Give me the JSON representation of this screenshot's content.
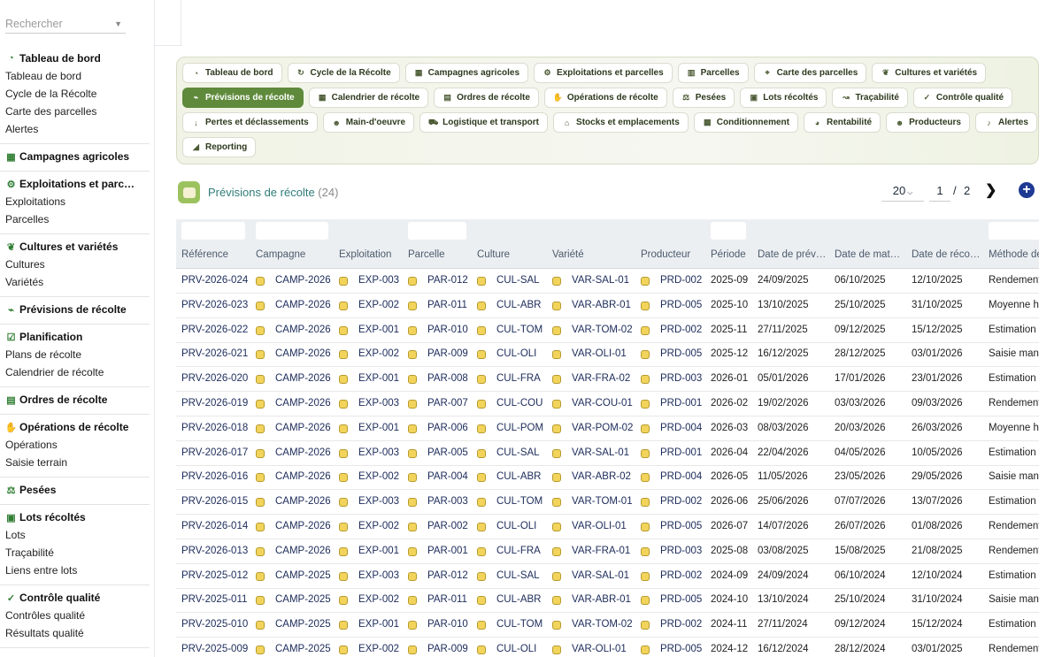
{
  "sidebar": {
    "search_placeholder": "Rechercher",
    "sections": [
      {
        "title": "Tableau de bord",
        "icon": "gauge-icon",
        "items": [
          "Tableau de bord",
          "Cycle de la Récolte",
          "Carte des parcelles",
          "Alertes"
        ]
      },
      {
        "title": "Campagnes agricoles",
        "icon": "calendar-icon",
        "items": []
      },
      {
        "title": "Exploitations et parc…",
        "icon": "tractor-icon",
        "items": [
          "Exploitations",
          "Parcelles"
        ]
      },
      {
        "title": "Cultures et variétés",
        "icon": "seedling-icon",
        "items": [
          "Cultures",
          "Variétés"
        ]
      },
      {
        "title": "Prévisions de récolte",
        "icon": "chart-line-icon",
        "items": []
      },
      {
        "title": "Planification",
        "icon": "clipboard-check-icon",
        "items": [
          "Plans de récolte",
          "Calendrier de récolte"
        ]
      },
      {
        "title": "Ordres de récolte",
        "icon": "clipboard-icon",
        "items": []
      },
      {
        "title": "Opérations de récolte",
        "icon": "hand-icon",
        "items": [
          "Opérations",
          "Saisie terrain"
        ]
      },
      {
        "title": "Pesées",
        "icon": "scale-icon",
        "items": []
      },
      {
        "title": "Lots récoltés",
        "icon": "boxes-icon",
        "items": [
          "Lots",
          "Traçabilité",
          "Liens entre lots"
        ]
      },
      {
        "title": "Contrôle qualité",
        "icon": "check-icon",
        "items": [
          "Contrôles qualité",
          "Résultats qualité"
        ]
      }
    ]
  },
  "tabs": [
    [
      {
        "label": "Tableau de bord",
        "icon": "gauge-icon"
      },
      {
        "label": "Cycle de la Récolte",
        "icon": "sync-icon"
      },
      {
        "label": "Campagnes agricoles",
        "icon": "calendar-icon"
      },
      {
        "label": "Exploitations et parcelles",
        "icon": "tractor-icon"
      },
      {
        "label": "Parcelles",
        "icon": "map-icon"
      },
      {
        "label": "Carte des parcelles",
        "icon": "map-marked-icon"
      },
      {
        "label": "Cultures et variétés",
        "icon": "seedling-icon"
      }
    ],
    [
      {
        "label": "Prévisions de récolte",
        "icon": "chart-line-icon",
        "active": true
      },
      {
        "label": "Calendrier de récolte",
        "icon": "calendar-icon"
      },
      {
        "label": "Ordres de récolte",
        "icon": "clipboard-icon"
      },
      {
        "label": "Opérations de récolte",
        "icon": "hand-icon"
      },
      {
        "label": "Pesées",
        "icon": "scale-icon"
      },
      {
        "label": "Lots récoltés",
        "icon": "boxes-icon"
      },
      {
        "label": "Traçabilité",
        "icon": "route-icon"
      },
      {
        "label": "Contrôle qualité",
        "icon": "check-icon"
      }
    ],
    [
      {
        "label": "Pertes et déclassements",
        "icon": "arrow-down-icon"
      },
      {
        "label": "Main-d'oeuvre",
        "icon": "users-icon"
      },
      {
        "label": "Logistique et transport",
        "icon": "truck-icon"
      },
      {
        "label": "Stocks et emplacements",
        "icon": "warehouse-icon"
      },
      {
        "label": "Conditionnement",
        "icon": "pallet-icon"
      },
      {
        "label": "Rentabilité",
        "icon": "pie-chart-icon"
      },
      {
        "label": "Producteurs",
        "icon": "users-icon"
      },
      {
        "label": "Alertes",
        "icon": "bell-icon"
      }
    ],
    [
      {
        "label": "Reporting",
        "icon": "chart-area-icon"
      }
    ]
  ],
  "list": {
    "title": "Prévisions de récolte",
    "count": "(24)",
    "page_size": "20",
    "page": "1",
    "page_sep": "/",
    "total_pages": "2"
  },
  "columns": [
    "Référence",
    "Campagne",
    "Exploitation",
    "Parcelle",
    "Culture",
    "Variété",
    "Producteur",
    "Période",
    "Date de prév…",
    "Date de mat…",
    "Date de réco…",
    "Méthode de"
  ],
  "rows": [
    [
      "PRV-2026-024",
      "CAMP-2026",
      "EXP-003",
      "PAR-012",
      "CUL-SAL",
      "VAR-SAL-01",
      "PRD-002",
      "2025-09",
      "24/09/2025",
      "06/10/2025",
      "12/10/2025",
      "Rendement"
    ],
    [
      "PRV-2026-023",
      "CAMP-2026",
      "EXP-002",
      "PAR-011",
      "CUL-ABR",
      "VAR-ABR-01",
      "PRD-005",
      "2025-10",
      "13/10/2025",
      "25/10/2025",
      "31/10/2025",
      "Moyenne hi"
    ],
    [
      "PRV-2026-022",
      "CAMP-2026",
      "EXP-001",
      "PAR-010",
      "CUL-TOM",
      "VAR-TOM-02",
      "PRD-002",
      "2025-11",
      "27/11/2025",
      "09/12/2025",
      "15/12/2025",
      "Estimation a"
    ],
    [
      "PRV-2026-021",
      "CAMP-2026",
      "EXP-002",
      "PAR-009",
      "CUL-OLI",
      "VAR-OLI-01",
      "PRD-005",
      "2025-12",
      "16/12/2025",
      "28/12/2025",
      "03/01/2026",
      "Saisie manu"
    ],
    [
      "PRV-2026-020",
      "CAMP-2026",
      "EXP-001",
      "PAR-008",
      "CUL-FRA",
      "VAR-FRA-02",
      "PRD-003",
      "2026-01",
      "05/01/2026",
      "17/01/2026",
      "23/01/2026",
      "Estimation p"
    ],
    [
      "PRV-2026-019",
      "CAMP-2026",
      "EXP-003",
      "PAR-007",
      "CUL-COU",
      "VAR-COU-01",
      "PRD-001",
      "2026-02",
      "19/02/2026",
      "03/03/2026",
      "09/03/2026",
      "Rendement"
    ],
    [
      "PRV-2026-018",
      "CAMP-2026",
      "EXP-001",
      "PAR-006",
      "CUL-POM",
      "VAR-POM-02",
      "PRD-004",
      "2026-03",
      "08/03/2026",
      "20/03/2026",
      "26/03/2026",
      "Moyenne hi"
    ],
    [
      "PRV-2026-017",
      "CAMP-2026",
      "EXP-003",
      "PAR-005",
      "CUL-SAL",
      "VAR-SAL-01",
      "PRD-001",
      "2026-04",
      "22/04/2026",
      "04/05/2026",
      "10/05/2026",
      "Estimation a"
    ],
    [
      "PRV-2026-016",
      "CAMP-2026",
      "EXP-002",
      "PAR-004",
      "CUL-ABR",
      "VAR-ABR-02",
      "PRD-004",
      "2026-05",
      "11/05/2026",
      "23/05/2026",
      "29/05/2026",
      "Saisie manu"
    ],
    [
      "PRV-2026-015",
      "CAMP-2026",
      "EXP-003",
      "PAR-003",
      "CUL-TOM",
      "VAR-TOM-01",
      "PRD-002",
      "2026-06",
      "25/06/2026",
      "07/07/2026",
      "13/07/2026",
      "Estimation p"
    ],
    [
      "PRV-2026-014",
      "CAMP-2026",
      "EXP-002",
      "PAR-002",
      "CUL-OLI",
      "VAR-OLI-01",
      "PRD-005",
      "2026-07",
      "14/07/2026",
      "26/07/2026",
      "01/08/2026",
      "Rendement"
    ],
    [
      "PRV-2026-013",
      "CAMP-2026",
      "EXP-001",
      "PAR-001",
      "CUL-FRA",
      "VAR-FRA-01",
      "PRD-003",
      "2025-08",
      "03/08/2025",
      "15/08/2025",
      "21/08/2025",
      "Rendement"
    ],
    [
      "PRV-2025-012",
      "CAMP-2025",
      "EXP-003",
      "PAR-012",
      "CUL-SAL",
      "VAR-SAL-01",
      "PRD-002",
      "2024-09",
      "24/09/2024",
      "06/10/2024",
      "12/10/2024",
      "Estimation a"
    ],
    [
      "PRV-2025-011",
      "CAMP-2025",
      "EXP-002",
      "PAR-011",
      "CUL-ABR",
      "VAR-ABR-01",
      "PRD-005",
      "2024-10",
      "13/10/2024",
      "25/10/2024",
      "31/10/2024",
      "Saisie manu"
    ],
    [
      "PRV-2025-010",
      "CAMP-2025",
      "EXP-001",
      "PAR-010",
      "CUL-TOM",
      "VAR-TOM-02",
      "PRD-002",
      "2024-11",
      "27/11/2024",
      "09/12/2024",
      "15/12/2024",
      "Estimation p"
    ],
    [
      "PRV-2025-009",
      "CAMP-2025",
      "EXP-002",
      "PAR-009",
      "CUL-OLI",
      "VAR-OLI-01",
      "PRD-005",
      "2024-12",
      "16/12/2024",
      "28/12/2024",
      "03/01/2025",
      "Rendement"
    ]
  ]
}
